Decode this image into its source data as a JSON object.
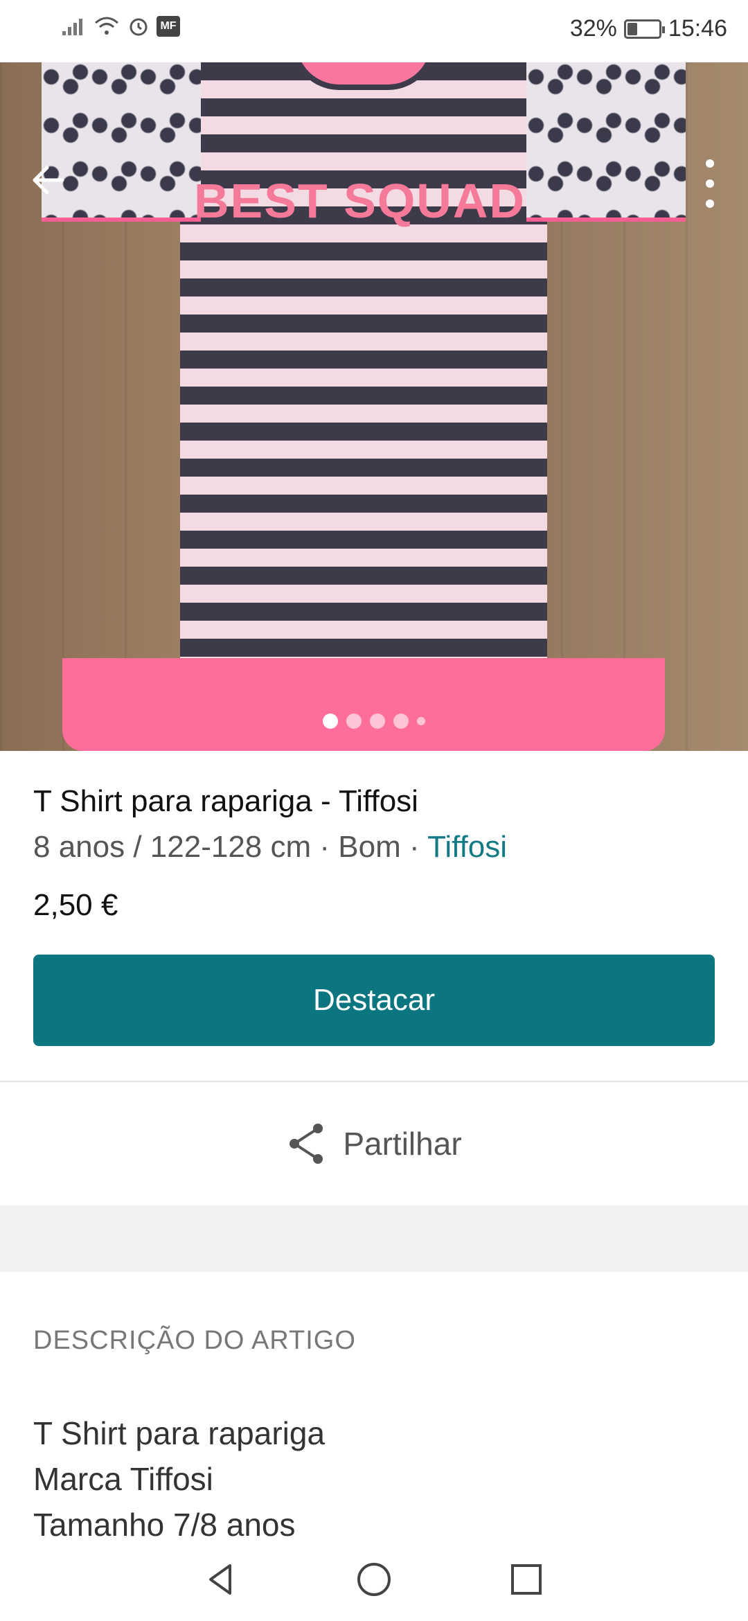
{
  "status_bar": {
    "badge": "MF",
    "battery_percent": "32%",
    "battery_level": 0.32,
    "time": "15:46",
    "icons": [
      "signal-icon",
      "wifi-icon",
      "alarm-icon",
      "battery-icon"
    ]
  },
  "hero": {
    "shirt_print_text": "BEST SQUAD",
    "image_count": 5,
    "active_index": 0
  },
  "item": {
    "title": "T Shirt para rapariga - Tiffosi",
    "size": "8 anos / 122-128 cm",
    "condition": "Bom",
    "separator": "·",
    "brand": "Tiffosi",
    "price": "2,50 €"
  },
  "actions": {
    "primary_label": "Destacar",
    "share_label": "Partilhar"
  },
  "description": {
    "section_title": "DESCRIÇÃO DO ARTIGO",
    "lines": [
      "T Shirt para rapariga",
      "Marca Tiffosi",
      "Tamanho 7/8 anos"
    ]
  },
  "colors": {
    "accent": "#0b7680",
    "brand_link": "#127a84"
  }
}
